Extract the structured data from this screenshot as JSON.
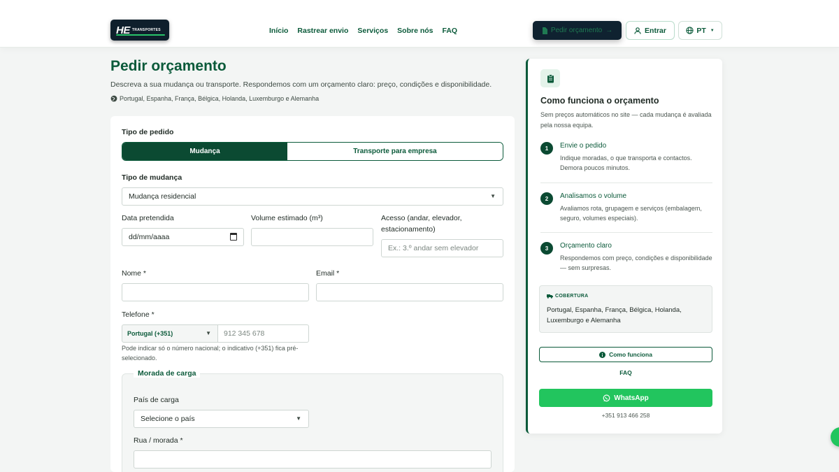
{
  "header": {
    "logo_mark": "HE",
    "logo_word": "TRANSPORTES",
    "nav": [
      "Início",
      "Rastrear envio",
      "Serviços",
      "Sobre nós",
      "FAQ"
    ],
    "quote_button": "Pedir orçamento",
    "login_button": "Entrar",
    "lang_button": "PT"
  },
  "intro": {
    "title": "Pedir orçamento",
    "subtitle": "Descreva a sua mudança ou transporte. Respondemos com um orçamento claro: preço, condições e disponibilidade.",
    "countries": "Portugal, Espanha, França, Bélgica, Holanda, Luxemburgo e Alemanha"
  },
  "form": {
    "order_type_label": "Tipo de pedido",
    "order_types": [
      "Mudança",
      "Transporte para empresa"
    ],
    "move_type_label": "Tipo de mudança",
    "move_type_value": "Mudança residencial",
    "date_label": "Data pretendida",
    "date_placeholder": "dd/mm/aaaa",
    "volume_label": "Volume estimado (m³)",
    "access_label": "Acesso (andar, elevador, estacionamento)",
    "access_placeholder": "Ex.: 3.º andar sem elevador",
    "name_label": "Nome *",
    "email_label": "Email *",
    "phone_label": "Telefone *",
    "phone_country": "Portugal (+351)",
    "phone_placeholder": "912 345 678",
    "phone_help": "Pode indicar só o número nacional; o indicativo (+351) fica pré-selecionado.",
    "pickup_legend": "Morada de carga",
    "pickup_country_label": "País de carga",
    "pickup_country_value": "Selecione o país",
    "pickup_street_label": "Rua / morada *"
  },
  "side": {
    "title": "Como funciona o orçamento",
    "subtitle": "Sem preços automáticos no site — cada mudança é avaliada pela nossa equipa.",
    "steps": [
      {
        "num": "1",
        "title": "Envie o pedido",
        "desc": "Indique moradas, o que transporta e contactos. Demora poucos minutos."
      },
      {
        "num": "2",
        "title": "Analisamos o volume",
        "desc": "Avaliamos rota, grupagem e serviços (embalagem, seguro, volumes especiais)."
      },
      {
        "num": "3",
        "title": "Orçamento claro",
        "desc": "Respondemos com preço, condições e disponibilidade — sem surpresas."
      }
    ],
    "coverage_head": "COBERTURA",
    "coverage_text": "Portugal, Espanha, França, Bélgica, Holanda, Luxemburgo e Alemanha",
    "how_button": "Como funciona",
    "faq_link": "FAQ",
    "whatsapp_button": "WhatsApp",
    "phone": "+351 913 466 258"
  },
  "colors": {
    "brand_green": "#0b5a3a",
    "dark_green": "#0b4a32",
    "whatsapp": "#22c55e",
    "navy": "#0f2230"
  }
}
